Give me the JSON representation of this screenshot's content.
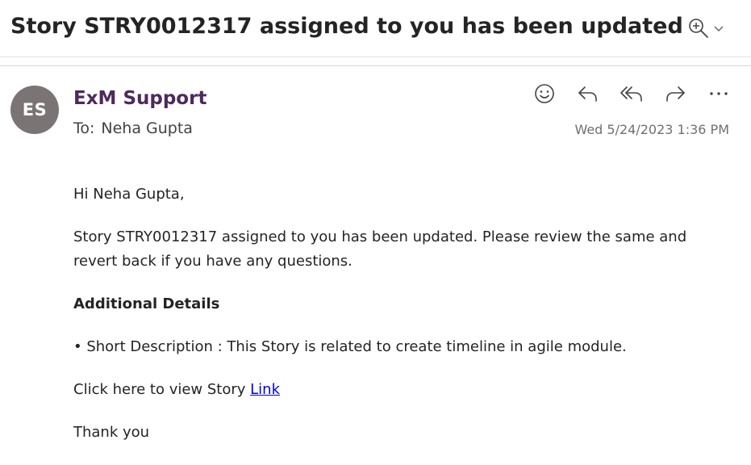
{
  "email": {
    "subject": "Story STRY0012317 assigned to you has been updated",
    "sender": {
      "initials": "ES",
      "name": "ExM Support",
      "avatar_color": "#7a7574",
      "name_color": "#4e2a5c"
    },
    "to_label": "To:",
    "recipient": "Neha Gupta",
    "timestamp": "Wed 5/24/2023 1:36 PM",
    "toolbar": {
      "zoom_icon": "zoom-in-icon",
      "actions": [
        "emoji-react-icon",
        "reply-icon",
        "reply-all-icon",
        "forward-icon",
        "more-options-icon"
      ]
    },
    "body": {
      "greeting": "Hi Neha Gupta,",
      "message": "Story  STRY0012317 assigned to you has been updated. Please review the same and revert back if you have any questions.",
      "details_heading": "Additional Details",
      "detail_item": "• Short Description : This Story is related to create timeline in agile module.",
      "link_prefix": "Click here to view Story ",
      "link_text": "Link",
      "link_color": "#0000ee",
      "closing": "Thank you"
    }
  }
}
